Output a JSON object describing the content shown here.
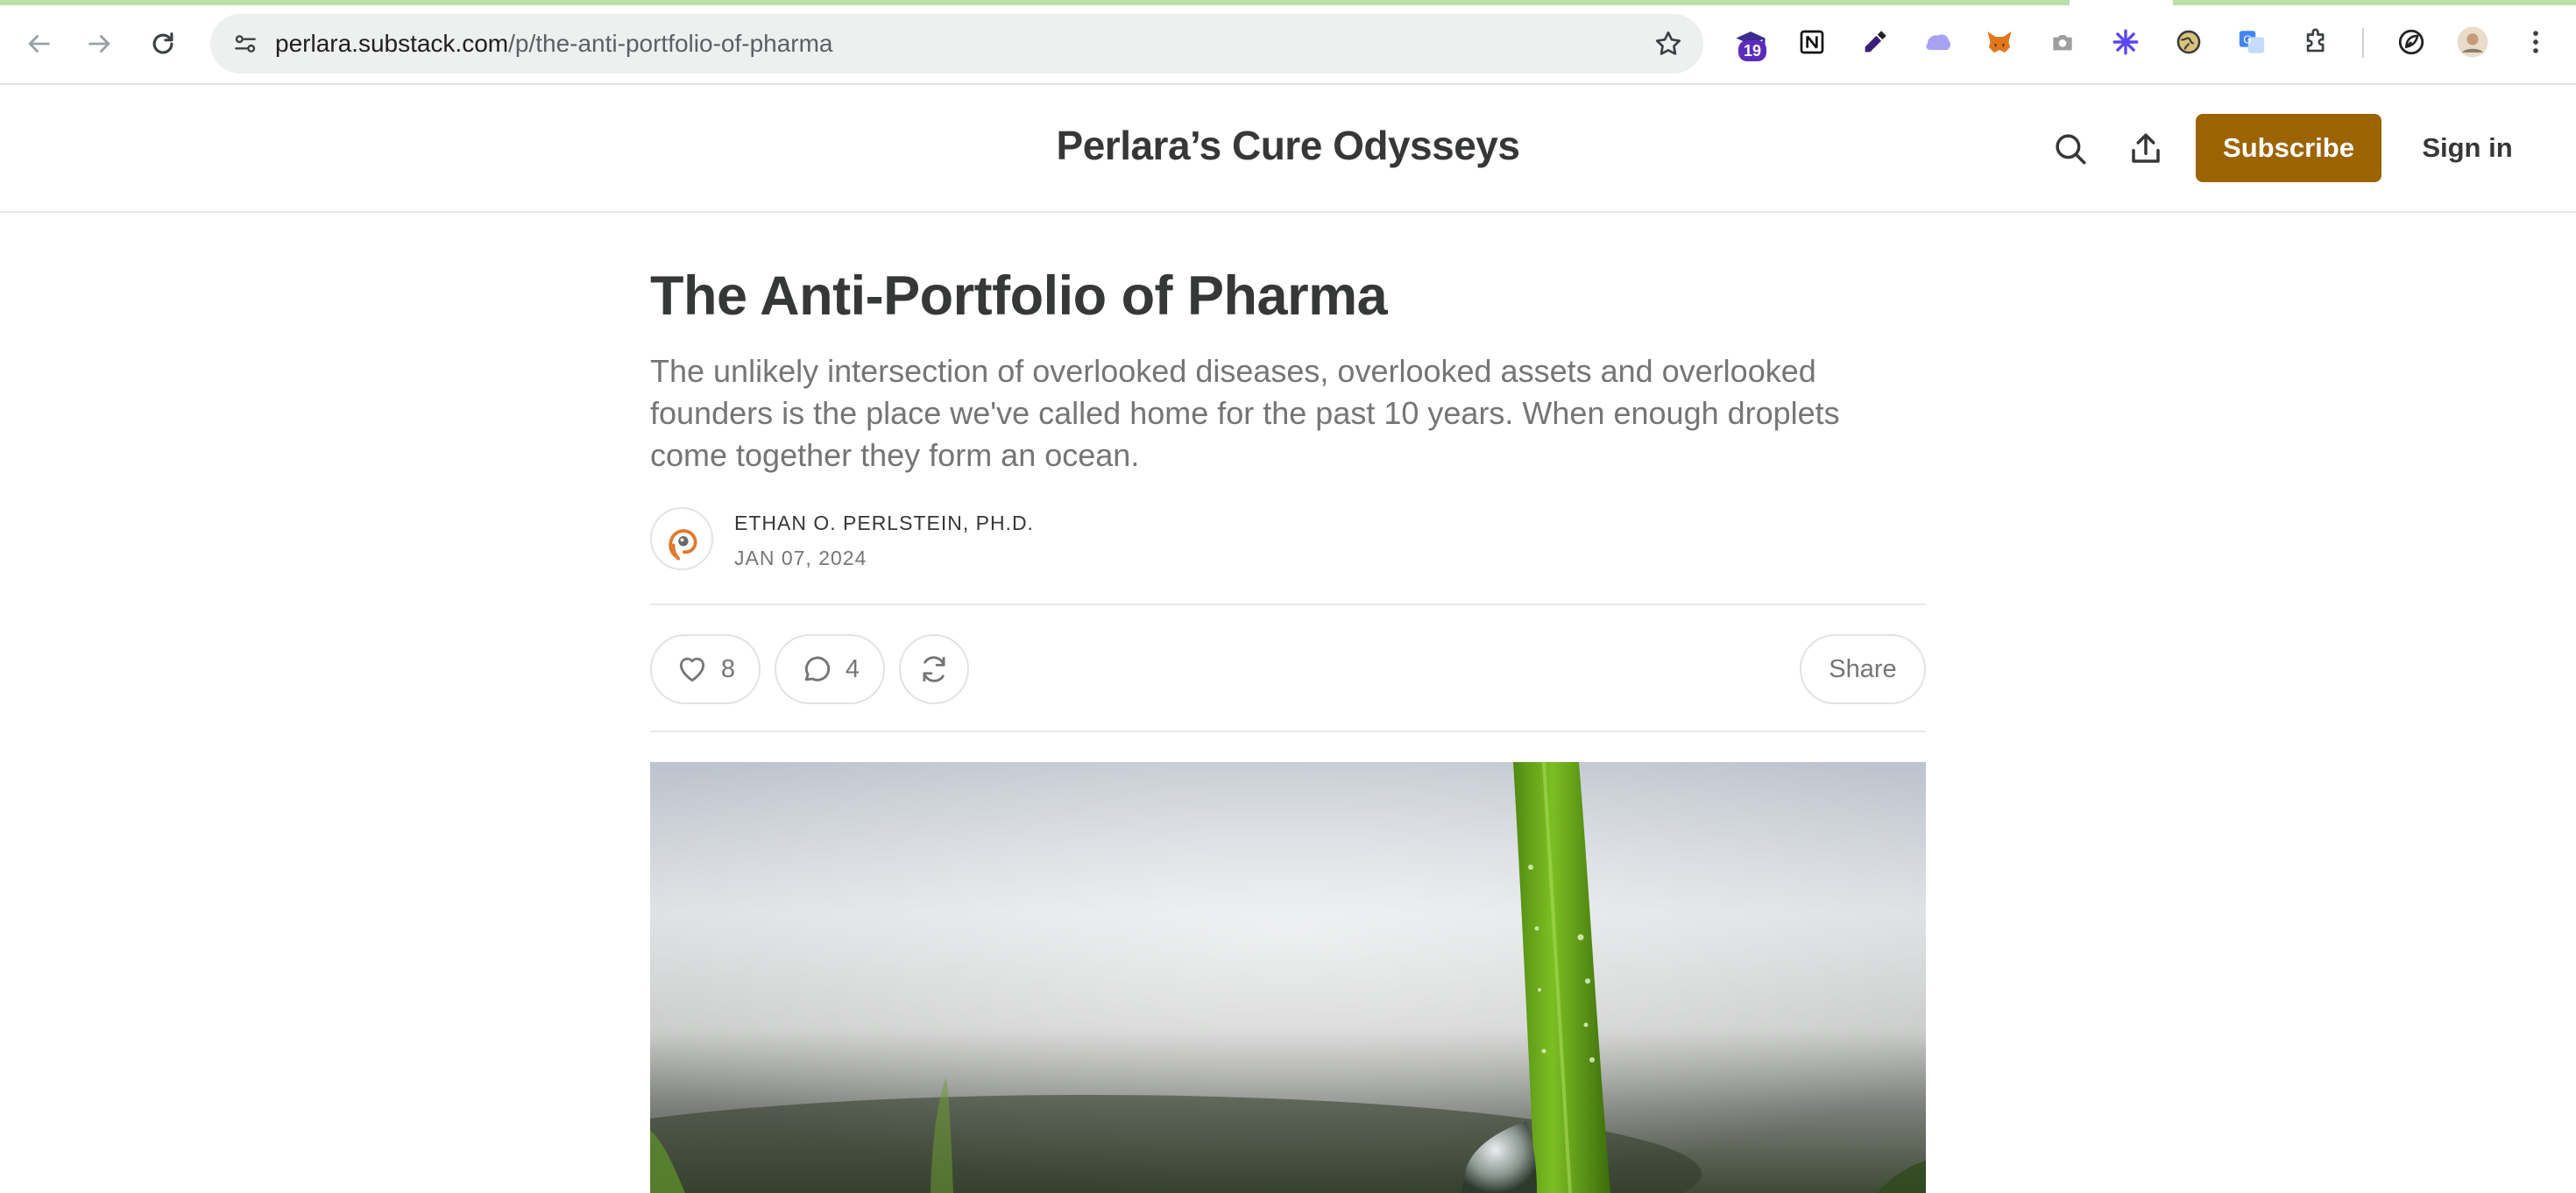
{
  "browser": {
    "url_host": "perlara.substack.com",
    "url_path": "/p/the-anti-portfolio-of-pharma",
    "extension_badge": "19"
  },
  "header": {
    "publication_name": "Perlara’s Cure Odysseys",
    "subscribe_label": "Subscribe",
    "signin_label": "Sign in"
  },
  "article": {
    "title": "The Anti-Portfolio of Pharma",
    "subtitle": "The unlikely intersection of overlooked diseases, overlooked assets and overlooked founders is the place we've called home for the past 10 years. When enough droplets come together they form an ocean.",
    "author": "ETHAN O. PERLSTEIN, PH.D.",
    "date": "JAN 07, 2024"
  },
  "actions": {
    "likes": "8",
    "comments": "4",
    "share_label": "Share"
  },
  "colors": {
    "accent": "#9b6400",
    "text": "#363737",
    "muted": "#757575"
  }
}
